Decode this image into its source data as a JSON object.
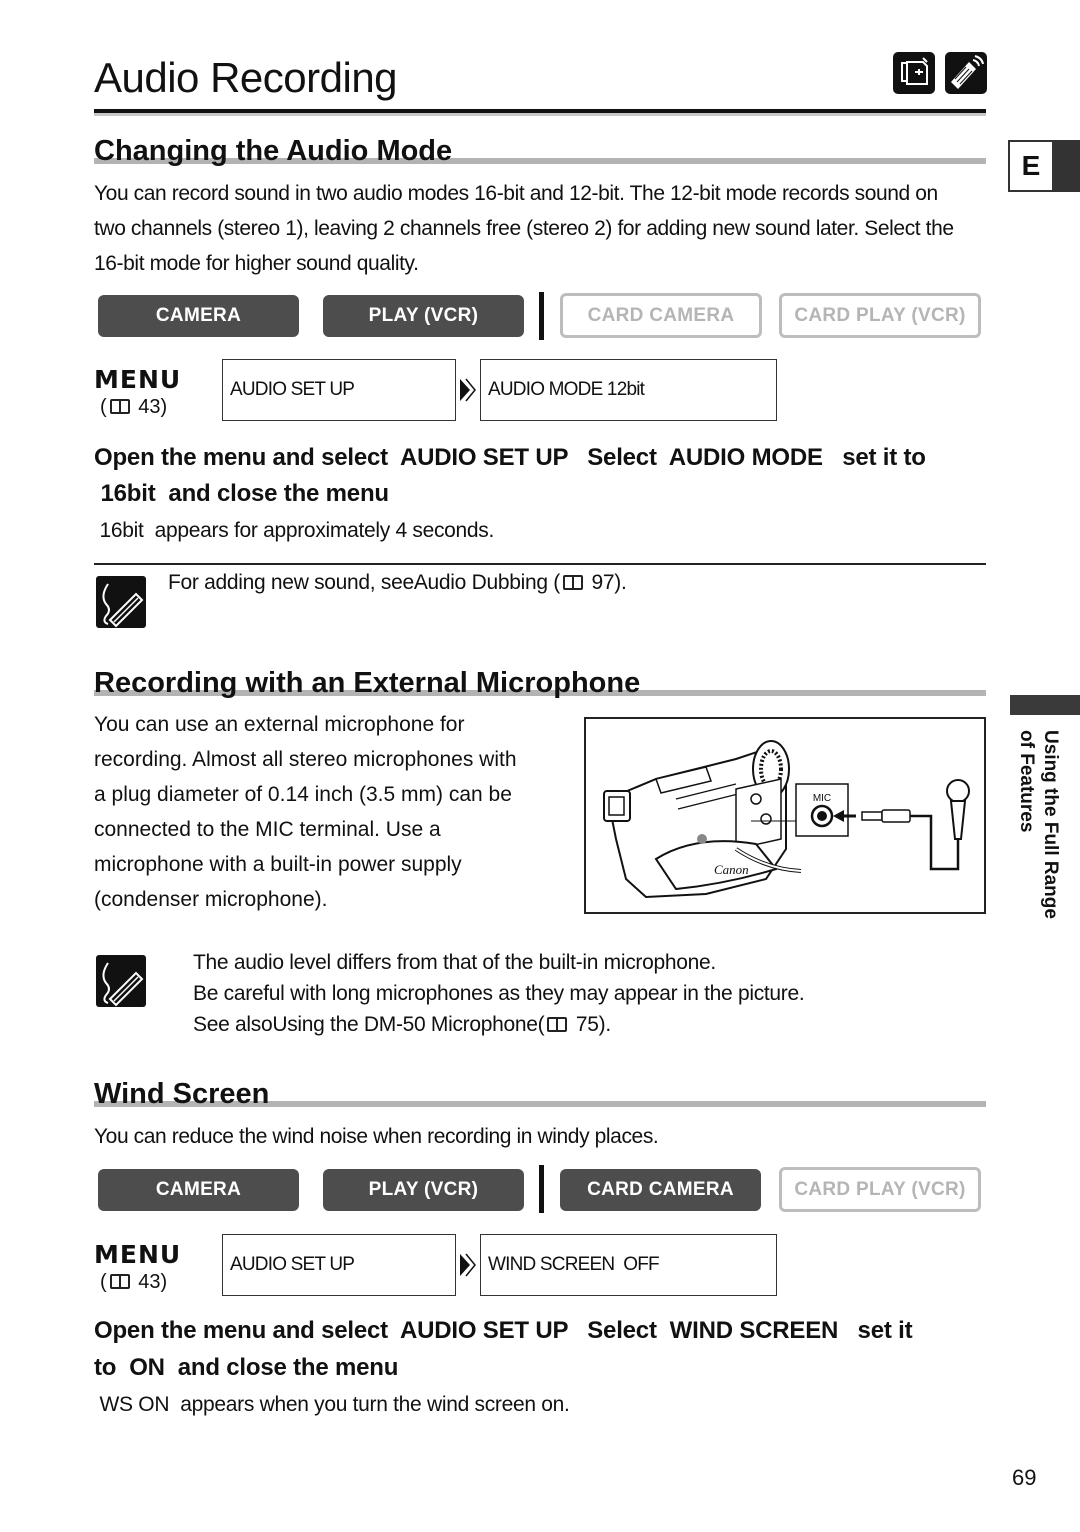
{
  "page": {
    "title": "Audio Recording",
    "language_tab": "E",
    "side_tab": "Using the Full Range of Features",
    "page_number": "69",
    "mode_icons": [
      "camcorder-icon",
      "remote-control-icon"
    ]
  },
  "sections": [
    {
      "heading": "Changing the Audio Mode",
      "body": "You can record sound in two audio modes 16-bit and 12-bit. The 12-bit mode records sound on two channels (stereo 1), leaving 2 channels free (stereo 2) for adding new sound later. Select the 16-bit mode for higher sound quality.",
      "modes": [
        {
          "label": "CAMERA",
          "active": true
        },
        {
          "label": "PLAY (VCR)",
          "active": true
        },
        {
          "label": "CARD CAMERA",
          "active": false
        },
        {
          "label": "CARD PLAY (VCR)",
          "active": false
        }
      ],
      "menu": {
        "label": "MENU",
        "ref": "43",
        "steps": [
          "AUDIO SET UP",
          "AUDIO MODE   12bit"
        ]
      },
      "instruction_line1": "Open the menu and select  AUDIO SET UP   Select  AUDIO MODE   set it to",
      "instruction_line2": " 16bit  and close the menu",
      "result": " 16bit  appears for approximately 4 seconds.",
      "note": {
        "text": "For adding new sound, see",
        "link": "Audio Dubbing (",
        "ref": "97",
        "end": ")."
      }
    },
    {
      "heading": "Recording with an External Microphone",
      "body_lines": [
        "You can use an external microphone for",
        "recording. Almost all stereo microphones with",
        "a plug diameter of 0.14 inch (3.5 mm) can be",
        "connected to the MIC terminal. Use a",
        "microphone with a built-in power supply",
        "(condenser microphone)."
      ],
      "figure_label": "MIC",
      "notes": [
        "The audio level differs from that of the built-in microphone.",
        "Be careful with long microphones as they may appear in the picture."
      ],
      "see_also": {
        "text": "See also",
        "link": "Using the DM-50 Microphone",
        "ref": "75",
        "end": ")."
      }
    },
    {
      "heading": "Wind Screen",
      "body": "You can reduce the wind noise when recording in windy places.",
      "modes": [
        {
          "label": "CAMERA",
          "active": true
        },
        {
          "label": "PLAY (VCR)",
          "active": true
        },
        {
          "label": "CARD CAMERA",
          "active": true
        },
        {
          "label": "CARD PLAY (VCR)",
          "active": false
        }
      ],
      "menu": {
        "label": "MENU",
        "ref": "43",
        "steps": [
          "AUDIO SET UP",
          "WIND SCREEN  OFF"
        ]
      },
      "instruction_line1": "Open the menu and select  AUDIO SET UP   Select  WIND SCREEN   set it",
      "instruction_line2": "to  ON  and close the menu",
      "result": " WS ON  appears when you turn the wind screen on."
    }
  ]
}
